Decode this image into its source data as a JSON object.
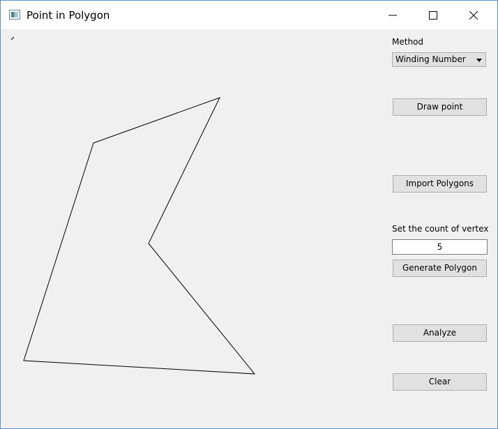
{
  "window": {
    "title": "Point in Polygon",
    "icon": "app-window-icon",
    "controls": [
      "minimize-icon",
      "maximize-icon",
      "close-icon"
    ]
  },
  "panel": {
    "method_label": "Method",
    "method_value": "Winding Number",
    "draw_point_label": "Draw point",
    "import_label": "Import Polygons",
    "vertex_count_label": "Set the count of vertex",
    "vertex_count_value": "5",
    "generate_label": "Generate Polygon",
    "analyze_label": "Analyze",
    "clear_label": "Clear"
  },
  "canvas": {
    "polygon_stroke": "#000000",
    "background": "#f0f0f0"
  }
}
